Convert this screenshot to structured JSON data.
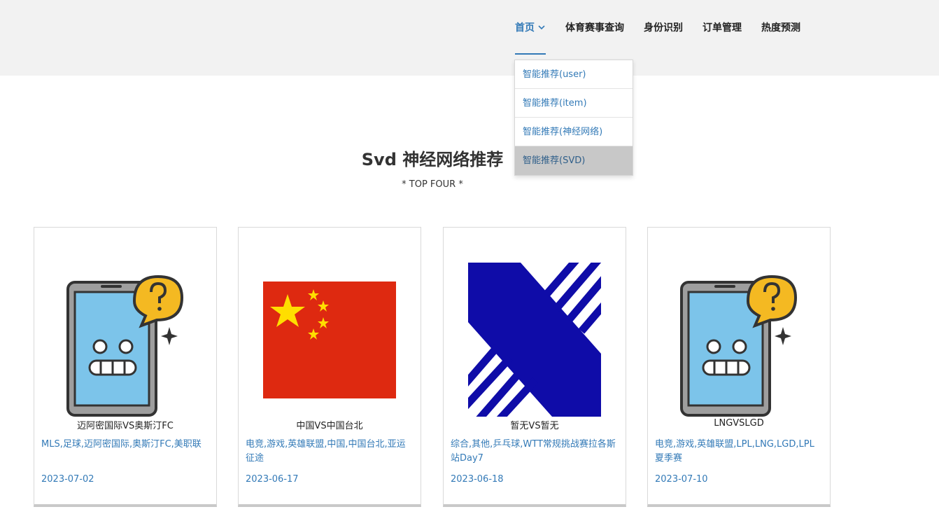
{
  "nav": {
    "items": [
      {
        "label": "首页",
        "active": true
      },
      {
        "label": "体育赛事查询"
      },
      {
        "label": "身份识别"
      },
      {
        "label": "订单管理"
      },
      {
        "label": "热度预测"
      }
    ]
  },
  "dropdown": {
    "items": [
      {
        "label": "智能推荐(user)"
      },
      {
        "label": "智能推荐(item)"
      },
      {
        "label": "智能推荐(神经网络)"
      },
      {
        "label": "智能推荐(SVD)",
        "highlighted": true
      }
    ]
  },
  "main": {
    "title": "Svd 神经网络推荐",
    "subtitle": "* TOP FOUR *"
  },
  "cards": [
    {
      "image": "robot-question-icon",
      "name": "迈阿密国际VS奥斯汀FC",
      "tags": "MLS,足球,迈阿密国际,奥斯汀FC,美职联",
      "date": "2023-07-02"
    },
    {
      "image": "china-flag",
      "name": "中国VS中国台北",
      "tags": "电竞,游戏,英雄联盟,中国,中国台北,亚运征途",
      "date": "2023-06-17"
    },
    {
      "image": "blue-x-logo",
      "name": "暂无VS暂无",
      "tags": "综合,其他,乒乓球,WTT常规挑战赛拉各斯站Day7",
      "date": "2023-06-18"
    },
    {
      "image": "robot-question-icon",
      "name": "LNGVSLGD",
      "tags": "电竞,游戏,英雄联盟,LPL,LNG,LGD,LPL夏季赛",
      "date": "2023-07-10"
    }
  ],
  "colors": {
    "link": "#337ab7",
    "header_bg": "#f2f2f2",
    "flag_red": "#de2910",
    "flag_yellow": "#ffde00",
    "logo_blue": "#0f0ca8"
  }
}
